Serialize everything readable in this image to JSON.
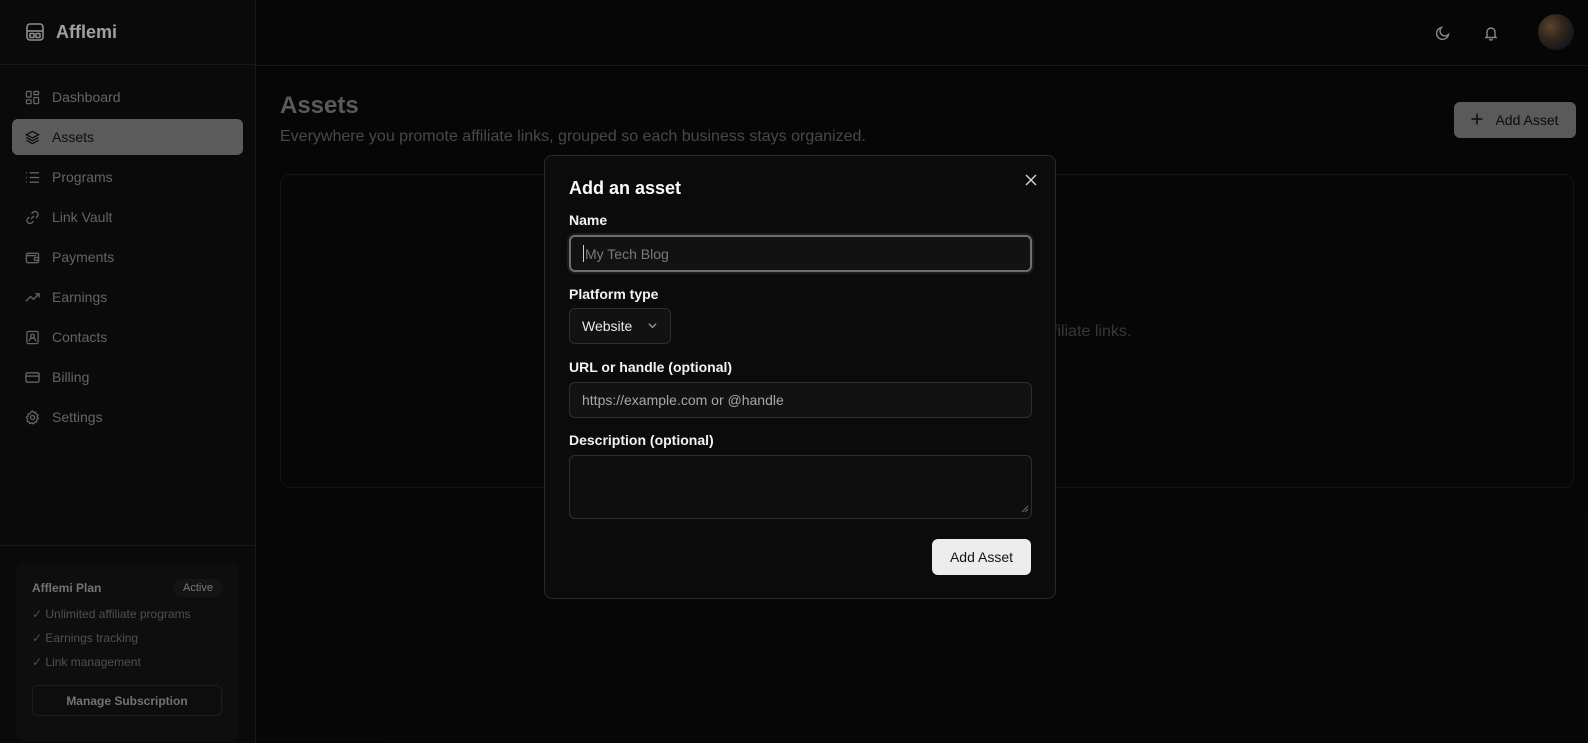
{
  "app": {
    "name": "Afflemi"
  },
  "sidebar": {
    "items": [
      {
        "label": "Dashboard",
        "icon": "dashboard-icon",
        "active": false
      },
      {
        "label": "Assets",
        "icon": "layers-icon",
        "active": true
      },
      {
        "label": "Programs",
        "icon": "list-icon",
        "active": false
      },
      {
        "label": "Link Vault",
        "icon": "link-icon",
        "active": false
      },
      {
        "label": "Payments",
        "icon": "wallet-icon",
        "active": false
      },
      {
        "label": "Earnings",
        "icon": "trending-up-icon",
        "active": false
      },
      {
        "label": "Contacts",
        "icon": "contact-icon",
        "active": false
      },
      {
        "label": "Billing",
        "icon": "credit-card-icon",
        "active": false
      },
      {
        "label": "Settings",
        "icon": "gear-icon",
        "active": false
      }
    ],
    "plan": {
      "title": "Afflemi Plan",
      "badge": "Active",
      "features": [
        "✓ Unlimited affiliate programs",
        "✓ Earnings tracking",
        "✓ Link management"
      ],
      "button": "Manage Subscription"
    }
  },
  "header": {
    "theme_icon": "moon-icon",
    "notification_icon": "bell-icon"
  },
  "main": {
    "title": "Assets",
    "subtitle": "Everywhere you promote affiliate links, grouped so each business stays organized.",
    "add_button": "Add Asset",
    "panel_text": "affiliate links."
  },
  "modal": {
    "title": "Add an asset",
    "name_label": "Name",
    "name_placeholder": "My Tech Blog",
    "platform_label": "Platform type",
    "platform_value": "Website",
    "url_label": "URL or handle (optional)",
    "url_placeholder": "https://example.com or @handle",
    "description_label": "Description (optional)",
    "description_value": "",
    "submit": "Add Asset"
  },
  "colors": {
    "background": "#0a0a0a",
    "sidebar": "#101010",
    "active_item": "#8e8e8e",
    "primary_button": "#ededed"
  }
}
